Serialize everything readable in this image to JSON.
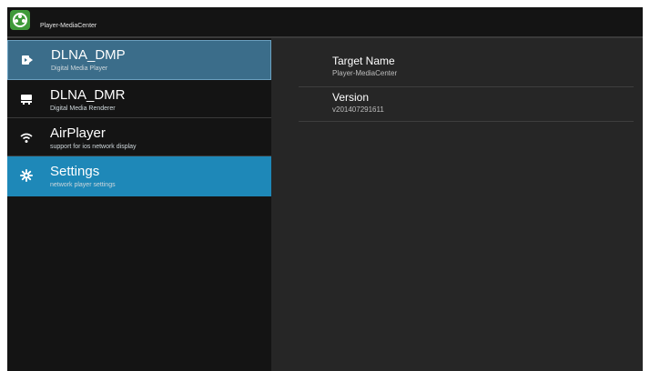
{
  "app": {
    "title": "Player-MediaCenter",
    "icon": "media-center-app-icon",
    "accent": "#1e88b8"
  },
  "sidebar": {
    "items": [
      {
        "label": "DLNA_DMP",
        "subtitle": "Digital Media Player",
        "icon": "dmp-icon",
        "state": "focused"
      },
      {
        "label": "DLNA_DMR",
        "subtitle": "Digital Media Renderer",
        "icon": "dmr-icon",
        "state": "normal"
      },
      {
        "label": "AirPlayer",
        "subtitle": "support for ios network display",
        "icon": "wifi-icon",
        "state": "normal"
      },
      {
        "label": "Settings",
        "subtitle": "network player settings",
        "icon": "gear-icon",
        "state": "selected"
      }
    ]
  },
  "details": {
    "rows": [
      {
        "label": "Target Name",
        "value": "Player-MediaCenter"
      },
      {
        "label": "Version",
        "value": "v201407291611"
      }
    ]
  }
}
